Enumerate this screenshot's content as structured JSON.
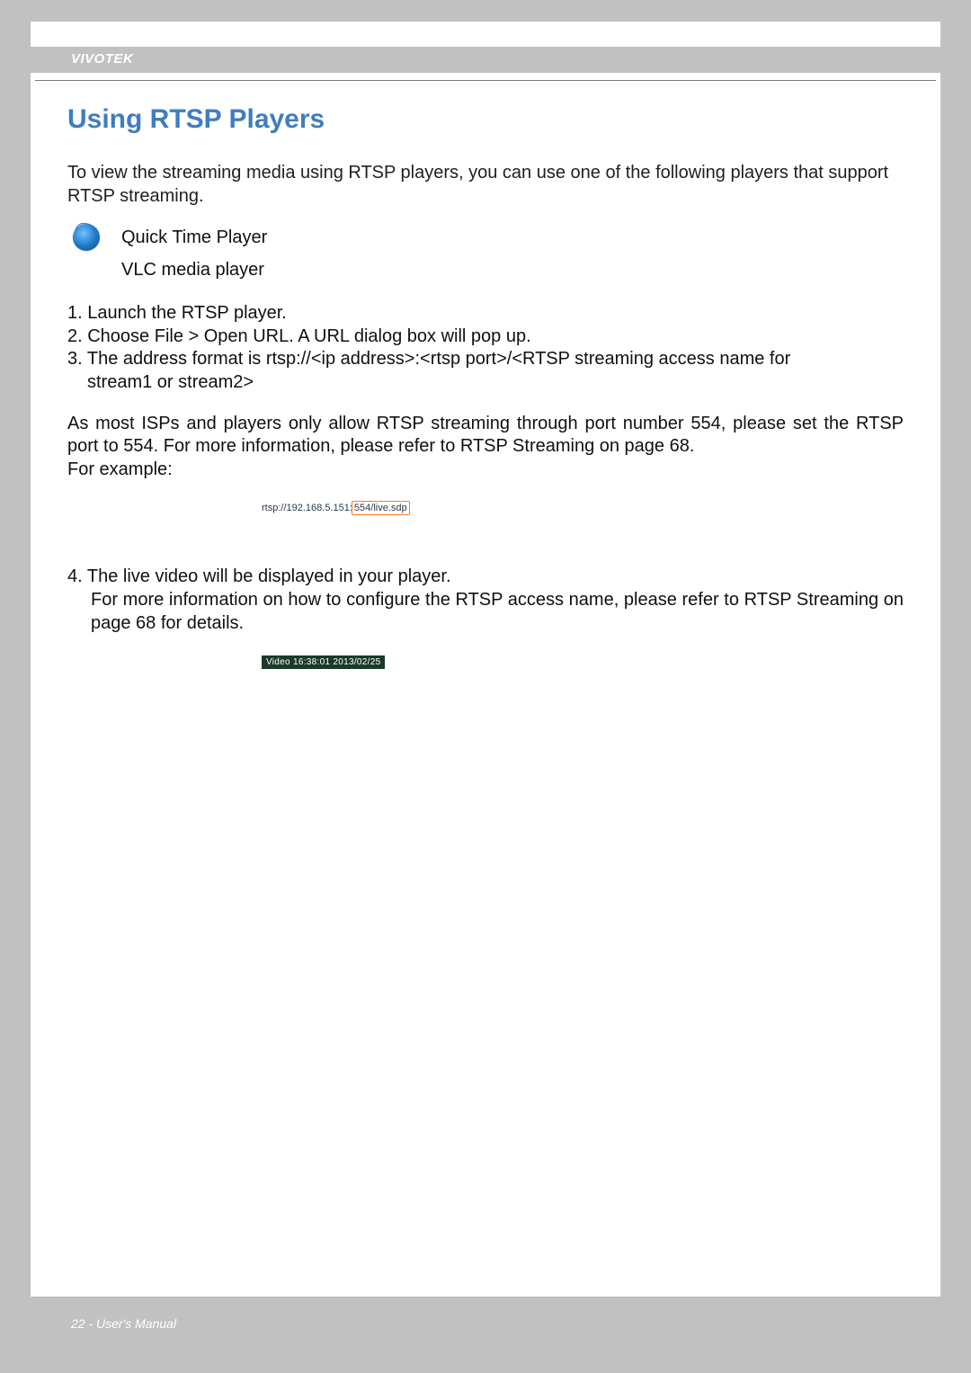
{
  "header": {
    "brand": "VIVOTEK"
  },
  "title": "Using RTSP Players",
  "intro": "To view the streaming media using RTSP players, you can use one of the following players that support RTSP streaming.",
  "players": {
    "quicktime": "Quick Time Player",
    "vlc": "VLC media player"
  },
  "steps123": {
    "s1": "1. Launch the RTSP player.",
    "s2": "2. Choose File > Open URL. A URL dialog box will pop up.",
    "s3_lead": "3. The address format is rtsp://<ip address>:<rtsp port>/<RTSP streaming access name for",
    "s3_cont": "stream1 or stream2>"
  },
  "isp_note": "As most ISPs and players only allow RTSP streaming through port number 554, please set the RTSP port to 554. For more information, please refer to RTSP Streaming on page 68.",
  "for_example": "For example:",
  "rtsp_example": {
    "prefix": "rtsp://192.168.5.151:",
    "highlight": "554/live.sdp"
  },
  "step4": {
    "lead": "4. The live video will be displayed in your player.",
    "cont": "For more information on how to configure the RTSP access name, please refer to RTSP Streaming on page 68 for details."
  },
  "video_overlay": "Video 16:38:01 2013/02/25",
  "footer": "22 - User's Manual"
}
